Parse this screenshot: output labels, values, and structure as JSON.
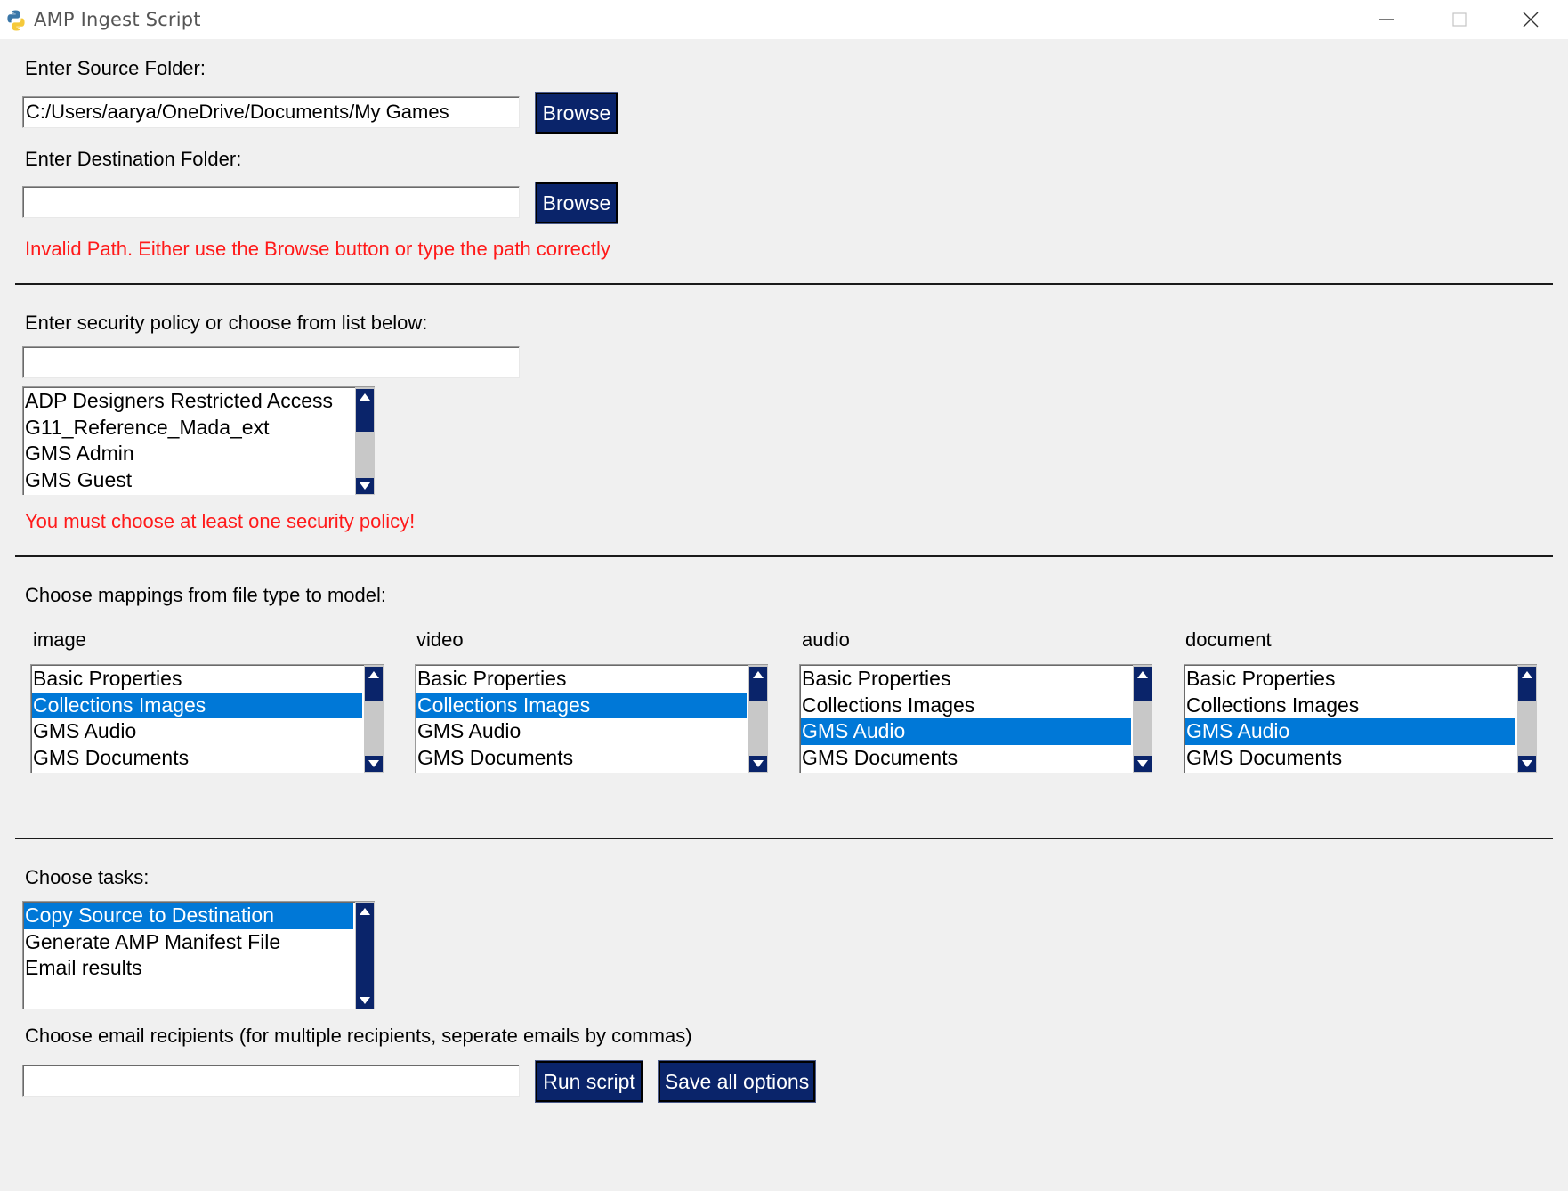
{
  "window": {
    "title": "AMP Ingest Script"
  },
  "source": {
    "label": "Enter Source Folder:",
    "value": "C:/Users/aarya/OneDrive/Documents/My Games",
    "browse_label": "Browse"
  },
  "destination": {
    "label": "Enter Destination Folder:",
    "value": "",
    "browse_label": "Browse",
    "error": "Invalid Path. Either use the Browse button or type the path correctly"
  },
  "security": {
    "label": "Enter security policy or choose from list below:",
    "value": "",
    "items": [
      "ADP Designers Restricted Access",
      "G11_Reference_Mada_ext",
      "GMS Admin",
      "GMS Guest"
    ],
    "error": "You must choose at least one security policy!"
  },
  "mappings": {
    "label": "Choose mappings from file type to model:",
    "columns": [
      {
        "name": "image",
        "items": [
          "Basic Properties",
          "Collections Images",
          "GMS Audio",
          "GMS Documents"
        ],
        "selected": "Collections Images"
      },
      {
        "name": "video",
        "items": [
          "Basic Properties",
          "Collections Images",
          "GMS Audio",
          "GMS Documents"
        ],
        "selected": "Collections Images"
      },
      {
        "name": "audio",
        "items": [
          "Basic Properties",
          "Collections Images",
          "GMS Audio",
          "GMS Documents"
        ],
        "selected": "GMS Audio"
      },
      {
        "name": "document",
        "items": [
          "Basic Properties",
          "Collections Images",
          "GMS Audio",
          "GMS Documents"
        ],
        "selected": "GMS Audio"
      }
    ]
  },
  "tasks": {
    "label": "Choose tasks:",
    "items": [
      "Copy Source to Destination",
      "Generate AMP Manifest File",
      "Email results"
    ],
    "selected": "Copy Source to Destination"
  },
  "email": {
    "label": "Choose email recipients (for multiple recipients, seperate emails by commas)",
    "value": "",
    "run_label": "Run script",
    "save_label": "Save all options"
  },
  "colors": {
    "button_bg": "#0a246a",
    "selection": "#0078d7",
    "error": "#ff1a1a"
  }
}
